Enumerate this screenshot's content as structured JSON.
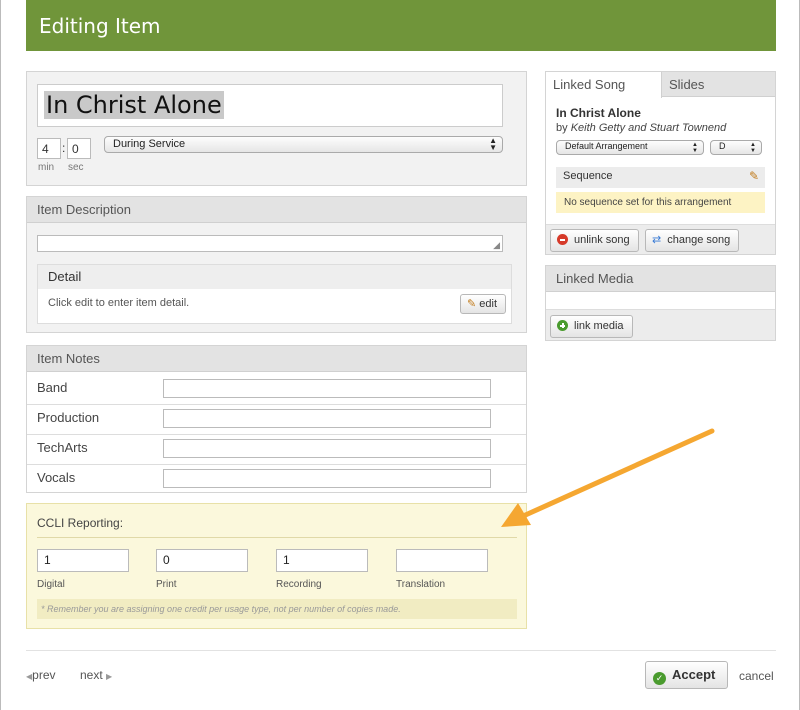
{
  "modal": {
    "title": "Editing Item"
  },
  "item": {
    "title": "In Christ Alone",
    "length_min": "4",
    "length_sec": "0",
    "min_label": "min",
    "sec_label": "sec",
    "timing": "During Service"
  },
  "description": {
    "heading": "Item Description",
    "detail_heading": "Detail",
    "detail_text": "Click edit to enter item detail.",
    "edit_label": "edit"
  },
  "notes": {
    "heading": "Item Notes",
    "rows": [
      {
        "label": "Band",
        "value": ""
      },
      {
        "label": "Production",
        "value": ""
      },
      {
        "label": "TechArts",
        "value": ""
      },
      {
        "label": "Vocals",
        "value": ""
      }
    ]
  },
  "ccli": {
    "heading": "CCLI Reporting:",
    "fields": [
      {
        "label": "Digital",
        "value": "1"
      },
      {
        "label": "Print",
        "value": "0"
      },
      {
        "label": "Recording",
        "value": "1"
      },
      {
        "label": "Translation",
        "value": ""
      }
    ],
    "note": "* Remember you are assigning one credit per usage type, not per number of copies made."
  },
  "linked_song": {
    "tabs": [
      "Linked Song",
      "Slides"
    ],
    "title": "In Christ Alone",
    "by_prefix": "by",
    "authors": "Keith Getty and Stuart Townend",
    "arrangement": "Default Arrangement",
    "key": "D",
    "sequence_label": "Sequence",
    "sequence_empty": "No sequence set for this arrangement",
    "unlink_label": "unlink song",
    "change_label": "change song"
  },
  "linked_media": {
    "heading": "Linked Media",
    "link_label": "link media"
  },
  "footer": {
    "prev_label": "prev",
    "next_label": "next",
    "accept_label": "Accept",
    "cancel_label": "cancel"
  },
  "colors": {
    "header_green": "#70953a",
    "arrow_orange": "#f5a731",
    "ccli_bg": "#fbf8dc",
    "notice_yellow": "#fdf3c4"
  }
}
